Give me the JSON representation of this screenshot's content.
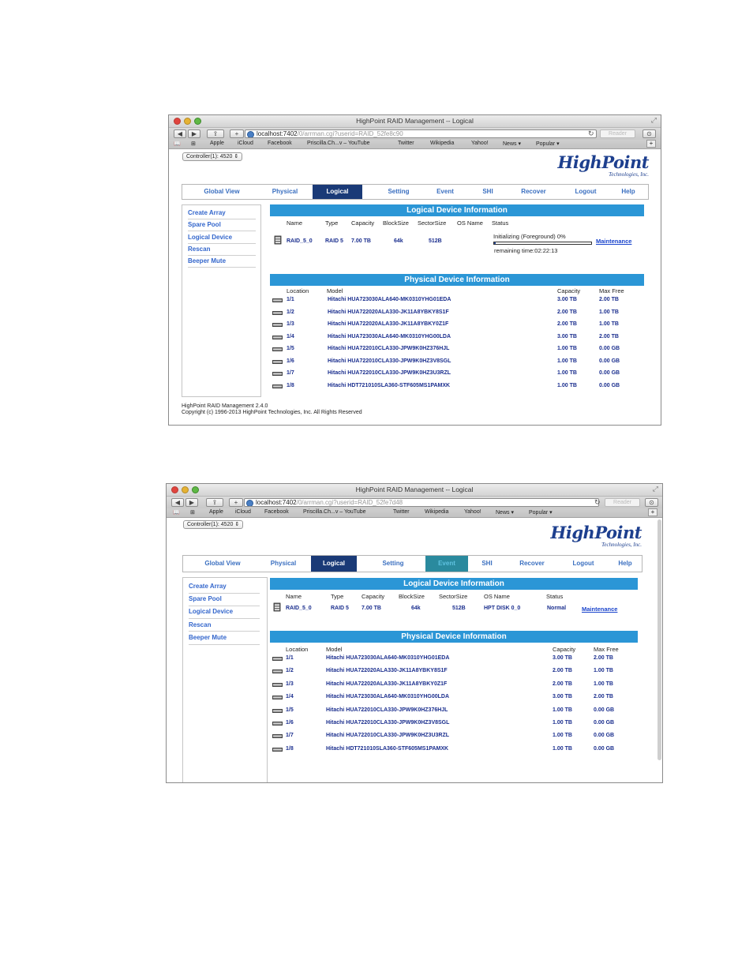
{
  "colors": {
    "accent_bar": "#2b96d6",
    "active_tab": "#1a3a77",
    "link": "#3366cc",
    "value_text": "#1a2e8e"
  },
  "win1": {
    "title": "HighPoint RAID Management -- Logical",
    "url_host": "localhost:7402",
    "url_path": "/0/arrman.cgi?userid=RAID_52fe8c90",
    "reader": "Reader",
    "bookmarks": [
      "Apple",
      "iCloud",
      "Facebook",
      "Priscilla.Ch...v – YouTube",
      "Twitter",
      "Wikipedia",
      "Yahoo!",
      "News ▾",
      "Popular ▾"
    ],
    "controller": "Controller(1): 4520",
    "logo": "HighPoint",
    "logo_sub": "Technologies, Inc.",
    "tabs": [
      "Global View",
      "Physical",
      "Logical",
      "Setting",
      "Event",
      "SHI",
      "Recover",
      "Logout",
      "Help"
    ],
    "sidebar": [
      "Create Array",
      "Spare Pool",
      "Logical Device",
      "Rescan",
      "Beeper Mute"
    ],
    "logical_title": "Logical Device Information",
    "logical_headers": [
      "Name",
      "Type",
      "Capacity",
      "BlockSize",
      "SectorSize",
      "OS Name",
      "Status"
    ],
    "logical_row": {
      "name": "RAID_5_0",
      "type": "RAID 5",
      "capacity": "7.00 TB",
      "blocksize": "64k",
      "sectorsize": "512B",
      "status": "Initializing (Foreground) 0%",
      "progress": 0.02,
      "remaining": "remaining time:02:22:13",
      "action": "Maintenance"
    },
    "physical_title": "Physical Device Information",
    "physical_headers": [
      "Location",
      "Model",
      "Capacity",
      "Max Free"
    ],
    "physical_rows": [
      {
        "location": "1/1",
        "model": "Hitachi HUA723030ALA640-MK0310YHG01EDA",
        "capacity": "3.00 TB",
        "maxfree": "2.00 TB"
      },
      {
        "location": "1/2",
        "model": "Hitachi HUA722020ALA330-JK11A8YBKY8S1F",
        "capacity": "2.00 TB",
        "maxfree": "1.00 TB"
      },
      {
        "location": "1/3",
        "model": "Hitachi HUA722020ALA330-JK11A8YBKY0Z1F",
        "capacity": "2.00 TB",
        "maxfree": "1.00 TB"
      },
      {
        "location": "1/4",
        "model": "Hitachi HUA723030ALA640-MK0310YHG00LDA",
        "capacity": "3.00 TB",
        "maxfree": "2.00 TB"
      },
      {
        "location": "1/5",
        "model": "Hitachi HUA722010CLA330-JPW9K0HZ376HJL",
        "capacity": "1.00 TB",
        "maxfree": "0.00 GB"
      },
      {
        "location": "1/6",
        "model": "Hitachi HUA722010CLA330-JPW9K0HZ3V8SGL",
        "capacity": "1.00 TB",
        "maxfree": "0.00 GB"
      },
      {
        "location": "1/7",
        "model": "Hitachi HUA722010CLA330-JPW9K0HZ3U3RZL",
        "capacity": "1.00 TB",
        "maxfree": "0.00 GB"
      },
      {
        "location": "1/8",
        "model": "Hitachi HDT721010SLA360-STF605MS1PAMXK",
        "capacity": "1.00 TB",
        "maxfree": "0.00 GB"
      }
    ],
    "footer1": "HighPoint RAID Management 2.4.0",
    "footer2": "Copyright (c) 1996-2013 HighPoint Technologies, Inc. All Rights Reserved"
  },
  "win2": {
    "title": "HighPoint RAID Management -- Logical",
    "url_host": "localhost:7402",
    "url_path": "/0/arrman.cgi?userid=RAID_52fe7d48",
    "reader": "Reader",
    "bookmarks": [
      "Apple",
      "iCloud",
      "Facebook",
      "Priscilla.Ch...v – YouTube",
      "Twitter",
      "Wikipedia",
      "Yahoo!",
      "News ▾",
      "Popular ▾"
    ],
    "controller": "Controller(1): 4520",
    "logo": "HighPoint",
    "logo_sub": "Technologies, Inc.",
    "tabs": [
      "Global View",
      "Physical",
      "Logical",
      "Setting",
      "Event",
      "SHI",
      "Recover",
      "Logout",
      "Help"
    ],
    "sidebar": [
      "Create Array",
      "Spare Pool",
      "Logical Device",
      "Rescan",
      "Beeper Mute"
    ],
    "logical_title": "Logical Device Information",
    "logical_headers": [
      "Name",
      "Type",
      "Capacity",
      "BlockSize",
      "SectorSize",
      "OS Name",
      "Status"
    ],
    "logical_row": {
      "name": "RAID_5_0",
      "type": "RAID 5",
      "capacity": "7.00 TB",
      "blocksize": "64k",
      "sectorsize": "512B",
      "osname": "HPT DISK 0_0",
      "status": "Normal",
      "action": "Maintenance"
    },
    "physical_title": "Physical Device Information",
    "physical_headers": [
      "Location",
      "Model",
      "Capacity",
      "Max Free"
    ],
    "physical_rows": [
      {
        "location": "1/1",
        "model": "Hitachi HUA723030ALA640-MK0310YHG01EDA",
        "capacity": "3.00 TB",
        "maxfree": "2.00 TB"
      },
      {
        "location": "1/2",
        "model": "Hitachi HUA722020ALA330-JK11A8YBKY8S1F",
        "capacity": "2.00 TB",
        "maxfree": "1.00 TB"
      },
      {
        "location": "1/3",
        "model": "Hitachi HUA722020ALA330-JK11A8YBKY0Z1F",
        "capacity": "2.00 TB",
        "maxfree": "1.00 TB"
      },
      {
        "location": "1/4",
        "model": "Hitachi HUA723030ALA640-MK0310YHG00LDA",
        "capacity": "3.00 TB",
        "maxfree": "2.00 TB"
      },
      {
        "location": "1/5",
        "model": "Hitachi HUA722010CLA330-JPW9K0HZ376HJL",
        "capacity": "1.00 TB",
        "maxfree": "0.00 GB"
      },
      {
        "location": "1/6",
        "model": "Hitachi HUA722010CLA330-JPW9K0HZ3V8SGL",
        "capacity": "1.00 TB",
        "maxfree": "0.00 GB"
      },
      {
        "location": "1/7",
        "model": "Hitachi HUA722010CLA330-JPW9K0HZ3U3RZL",
        "capacity": "1.00 TB",
        "maxfree": "0.00 GB"
      },
      {
        "location": "1/8",
        "model": "Hitachi HDT721010SLA360-STF605MS1PAMXK",
        "capacity": "1.00 TB",
        "maxfree": "0.00 GB"
      }
    ]
  }
}
